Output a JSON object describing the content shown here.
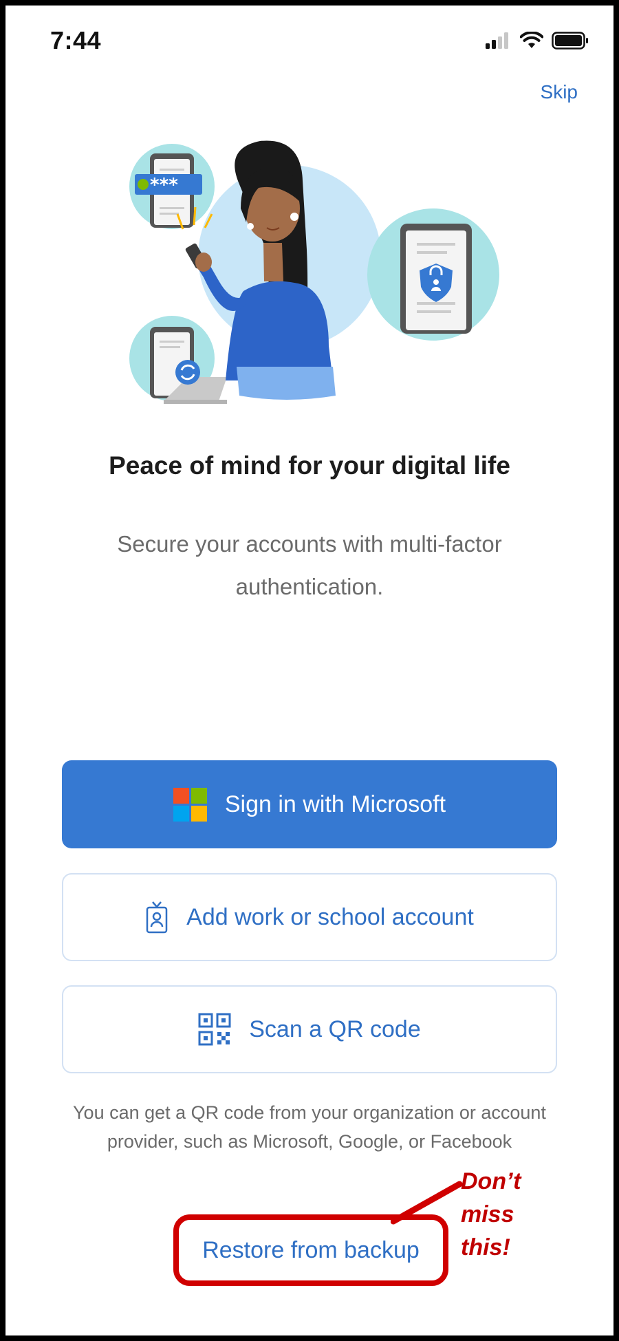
{
  "status_bar": {
    "time": "7:44",
    "icons": [
      "signal-icon",
      "wifi-icon",
      "battery-icon"
    ]
  },
  "skip_label": "Skip",
  "illustration": {
    "password_mask": "***",
    "icons": [
      "woman-with-phone-illustration",
      "password-phone-icon",
      "lock-phone-icon",
      "sync-laptop-icon"
    ]
  },
  "headline": "Peace of mind for your digital life",
  "subtext": "Secure your accounts with multi-factor authentication.",
  "buttons": {
    "microsoft": "Sign in with Microsoft",
    "work_school": "Add work or school account",
    "qr": "Scan a QR code"
  },
  "note": "You can get a QR code from your organization or account provider, such as Microsoft, Google, or Facebook",
  "restore_label": "Restore from backup",
  "annotation": "Don’t\nmiss\nthis!",
  "colors": {
    "accent": "#3679d2",
    "link": "#2f6fc4",
    "annotation_red": "#d00000",
    "ms_red": "#f25022",
    "ms_green": "#7fba00",
    "ms_blue": "#00a4ef",
    "ms_yellow": "#ffb900"
  }
}
